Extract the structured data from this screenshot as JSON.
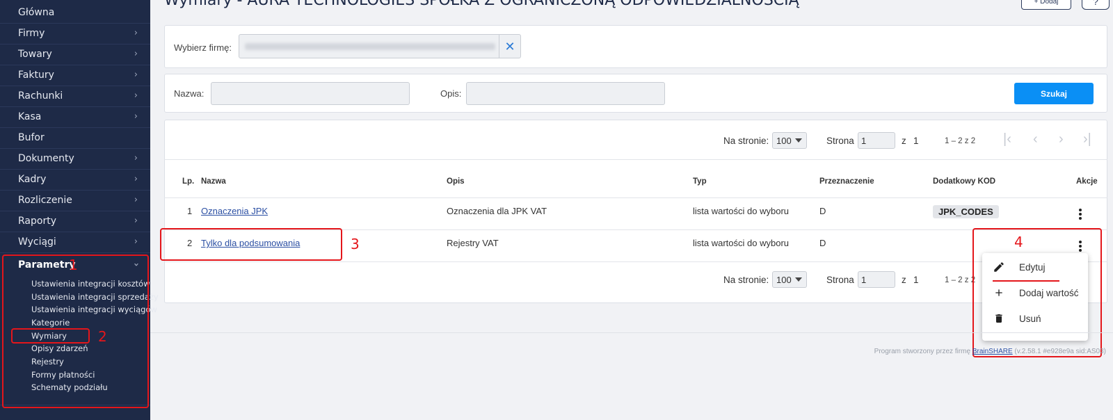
{
  "sidebar": {
    "items": [
      {
        "label": "Główna"
      },
      {
        "label": "Firmy"
      },
      {
        "label": "Towary"
      },
      {
        "label": "Faktury"
      },
      {
        "label": "Rachunki"
      },
      {
        "label": "Kasa"
      },
      {
        "label": "Bufor"
      },
      {
        "label": "Dokumenty"
      },
      {
        "label": "Kadry"
      },
      {
        "label": "Rozliczenie"
      },
      {
        "label": "Raporty"
      },
      {
        "label": "Wyciągi"
      },
      {
        "label": "Parametry"
      }
    ],
    "sub_items": [
      {
        "label": "Ustawienia integracji kosztów"
      },
      {
        "label": "Ustawienia integracji sprzedaży"
      },
      {
        "label": "Ustawienia integracji wyciągów"
      },
      {
        "label": "Kategorie"
      },
      {
        "label": "Wymiary"
      },
      {
        "label": "Opisy zdarzeń"
      },
      {
        "label": "Rejestry"
      },
      {
        "label": "Formy płatności"
      },
      {
        "label": "Schematy podziału"
      }
    ]
  },
  "annotations": [
    "1",
    "2",
    "3",
    "4"
  ],
  "header": {
    "title": "Wymiary - AURA TECHNOLOGIES SPÓŁKA Z OGRANICZONĄ ODPOWIEDZIALNOŚCIĄ",
    "add_label": "+ Dodaj",
    "help_label": "?"
  },
  "company_filter": {
    "label": "Wybierz firmę:",
    "clear_icon": "close-icon"
  },
  "search": {
    "name_label": "Nazwa:",
    "desc_label": "Opis:",
    "button": "Szukaj"
  },
  "pagination": {
    "per_page_label": "Na stronie:",
    "per_page_value": "100",
    "page_label": "Strona",
    "page_value": "1",
    "of_label": "z",
    "total_pages": "1",
    "range": "1 – 2 z 2"
  },
  "table": {
    "headers": [
      "Lp.",
      "Nazwa",
      "Opis",
      "Typ",
      "Przeznaczenie",
      "Dodatkowy KOD",
      "Akcje"
    ],
    "rows": [
      {
        "lp": "1",
        "nazwa": "Oznaczenia JPK",
        "opis": "Oznaczenia dla JPK VAT",
        "typ": "lista wartości do wyboru",
        "przeznaczenie": "D",
        "kod": "JPK_CODES"
      },
      {
        "lp": "2",
        "nazwa": "Tylko dla podsumowania",
        "opis": "Rejestry VAT",
        "typ": "lista wartości do wyboru",
        "przeznaczenie": "D",
        "kod": ""
      }
    ]
  },
  "context_menu": {
    "items": [
      {
        "label": "Edytuj",
        "icon": "pencil-icon"
      },
      {
        "label": "Dodaj wartość",
        "icon": "plus-icon"
      },
      {
        "label": "Usuń",
        "icon": "trash-icon"
      }
    ]
  },
  "footer": {
    "prefix": "Program stworzony przez firmę",
    "brand": "BrainSHARE",
    "version": "(v.2.58.1 #e928e9a sid:AS03)"
  },
  "colors": {
    "sidebar_bg": "#1e2a47",
    "primary": "#0a8ff5",
    "annotation": "#e4161b",
    "link": "#2b4fa3"
  }
}
